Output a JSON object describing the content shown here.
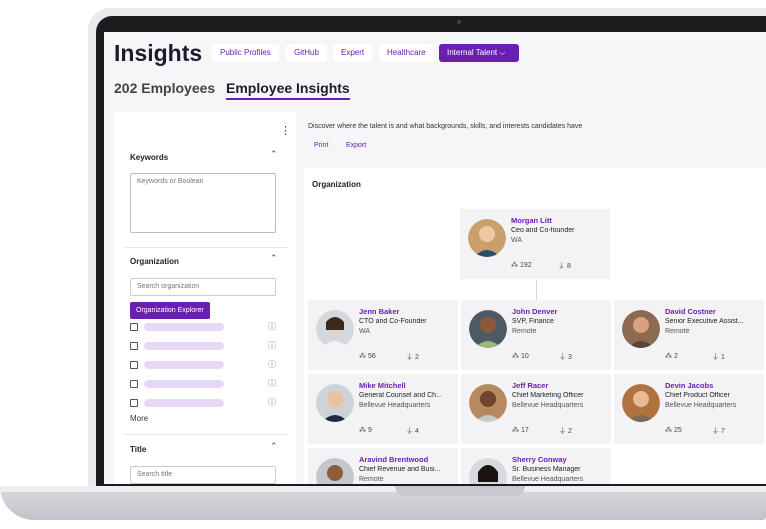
{
  "header": {
    "title": "Insights",
    "pills": [
      "Public Profiles",
      "GitHub",
      "Expert",
      "Healthcare"
    ],
    "active_pill": "Internal Talent ⌵"
  },
  "tabs": {
    "count_label": "202 Employees",
    "active_label": "Employee Insights"
  },
  "sidebar": {
    "kebab": "⋮",
    "chevron": "⌃",
    "info_glyph": "ⓘ",
    "keywords": {
      "heading": "Keywords",
      "placeholder": "Keywords or Boolean"
    },
    "organization": {
      "heading": "Organization",
      "search_placeholder": "Search organization",
      "explorer_button": "Organization Explorer",
      "more": "More"
    },
    "title_section": {
      "heading": "Title",
      "search_placeholder": "Search title"
    }
  },
  "content": {
    "description": "Discover where the talent is and what backgrounds, skills, and interests candidates have",
    "print_label": "Print",
    "export_label": "Export",
    "org_heading": "Organization"
  },
  "people": [
    {
      "name": "Morgan Litt",
      "role": "Ceo and Co-founder",
      "location": "WA",
      "stat1": "192",
      "stat2": "8"
    },
    {
      "name": "Jenn Baker",
      "role": "CTO and Co-Founder",
      "location": "WA",
      "stat1": "56",
      "stat2": "2"
    },
    {
      "name": "John Denver",
      "role": "SVP, Finance",
      "location": "Remote",
      "stat1": "10",
      "stat2": "3"
    },
    {
      "name": "David Costner",
      "role": "Senior Executive Assist...",
      "location": "Remote",
      "stat1": "2",
      "stat2": "1"
    },
    {
      "name": "Mike Mitchell",
      "role": "General Counsel and Ch...",
      "location": "Bellevue Headquarters",
      "stat1": "9",
      "stat2": "4"
    },
    {
      "name": "Jeff Racer",
      "role": "Chief Marketing Officer",
      "location": "Bellevue Headquarters",
      "stat1": "17",
      "stat2": "2"
    },
    {
      "name": "Devin Jacobs",
      "role": "Chief Product Officer",
      "location": "Bellevue Headquarters",
      "stat1": "25",
      "stat2": "7"
    },
    {
      "name": "Aravind Brentwood",
      "role": "Chief Revenue and Busi...",
      "location": "Remote",
      "stat1": "",
      "stat2": ""
    },
    {
      "name": "Sherry Conway",
      "role": "Sr. Business Manager",
      "location": "Bellevue Headquarters",
      "stat1": "",
      "stat2": ""
    }
  ],
  "colors": {
    "accent": "#6a1fb3",
    "bar": "#e6d9f7"
  }
}
